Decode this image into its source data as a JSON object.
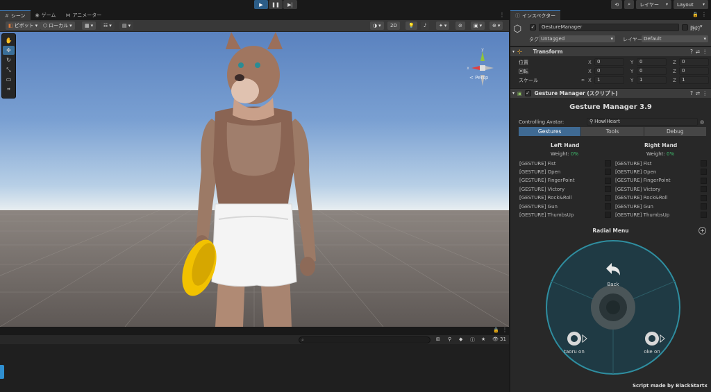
{
  "toolbar": {
    "play_icon": "play-icon",
    "pause_icon": "pause-icon",
    "step_icon": "step-icon",
    "layers_label": "レイヤー",
    "layout_label": "Layout"
  },
  "scene": {
    "tabs": [
      {
        "label": "シーン",
        "icon": "scene-icon"
      },
      {
        "label": "ゲーム",
        "icon": "game-icon"
      },
      {
        "label": "アニメーター",
        "icon": "animator-icon"
      }
    ],
    "pivot_label": "ピボット",
    "local_label": "ローカル",
    "mode_2d_label": "2D",
    "persp_label": "< Persp"
  },
  "console": {
    "search_placeholder": "",
    "count_label": "31"
  },
  "inspector": {
    "tab_label": "インスペクター",
    "object_name": "GestureManager",
    "static_label": "静的",
    "tag_label": "タグ",
    "tag_value": "Untagged",
    "layer_label": "レイヤー",
    "layer_value": "Default",
    "transform": {
      "title": "Transform",
      "position_label": "位置",
      "rotation_label": "回転",
      "scale_label": "スケール",
      "position": [
        "0",
        "0",
        "0"
      ],
      "rotation": [
        "0",
        "0",
        "0"
      ],
      "scale": [
        "1",
        "1",
        "1"
      ],
      "axes": [
        "X",
        "Y",
        "Z"
      ]
    },
    "gesture_manager": {
      "component_title": "Gesture Manager (スクリプト)",
      "title": "Gesture Manager 3.9",
      "controlling_label": "Controlling Avatar:",
      "avatar_name": "HowlHeart",
      "tabs": [
        "Gestures",
        "Tools",
        "Debug"
      ],
      "left_hand": "Left Hand",
      "right_hand": "Right Hand",
      "weight_label": "Weight:",
      "weight_value": "0%",
      "gestures": [
        "[GESTURE] Fist",
        "[GESTURE] Open",
        "[GESTURE] FingerPoint",
        "[GESTURE] Victory",
        "[GESTURE] Rock&Roll",
        "[GESTURE] Gun",
        "[GESTURE] ThumbsUp"
      ],
      "radial_title": "Radial Menu",
      "radial_back": "Back",
      "radial_left": "taoru on",
      "radial_right": "oke on",
      "credit": "Script made by BlackStartx"
    }
  }
}
